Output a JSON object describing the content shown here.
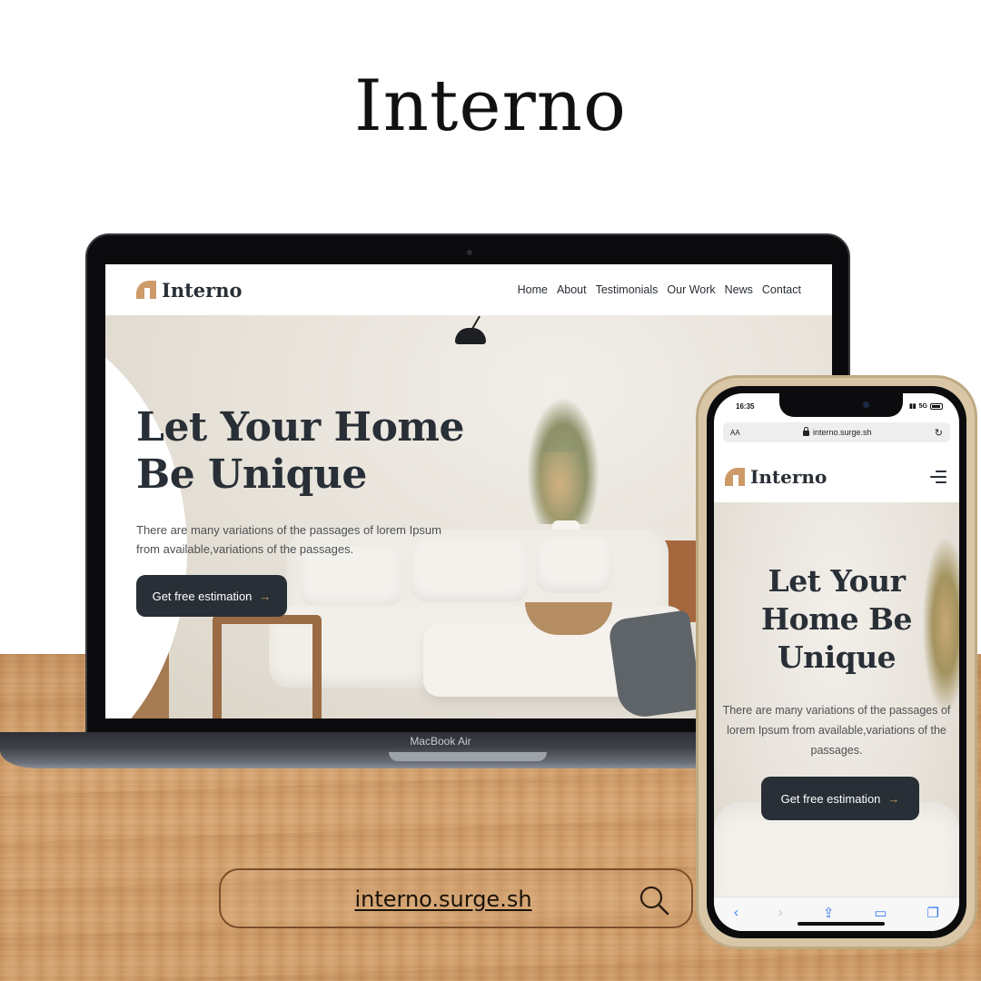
{
  "headline": "Interno",
  "laptop": {
    "brand": "Interno",
    "nav": [
      "Home",
      "About",
      "Testimonials",
      "Our Work",
      "News",
      "Contact"
    ],
    "hero_heading": "Let Your Home Be Unique",
    "hero_text": "There are many variations of the passages of lorem Ipsum from available,variations of the passages.",
    "cta": "Get free estimation",
    "model_label": "MacBook Air"
  },
  "phone": {
    "status_time": "16:35",
    "signal": "5G",
    "url_aa": "AA",
    "url": "interno.surge.sh",
    "brand": "Interno",
    "hero_heading": "Let Your Home Be Unique",
    "hero_text": "There are many variations of the passages of lorem Ipsum from available,variations of the passages.",
    "cta": "Get free estimation"
  },
  "search": {
    "text": "interno.surge.sh"
  },
  "colors": {
    "accent": "#cd9b6a",
    "dark": "#292f36",
    "ios_blue": "#3478f6"
  },
  "icons": {
    "logo": "interno-arch-logo-icon",
    "arrow": "arrow-right-icon",
    "search": "search-icon",
    "menu": "hamburger-menu-icon"
  }
}
